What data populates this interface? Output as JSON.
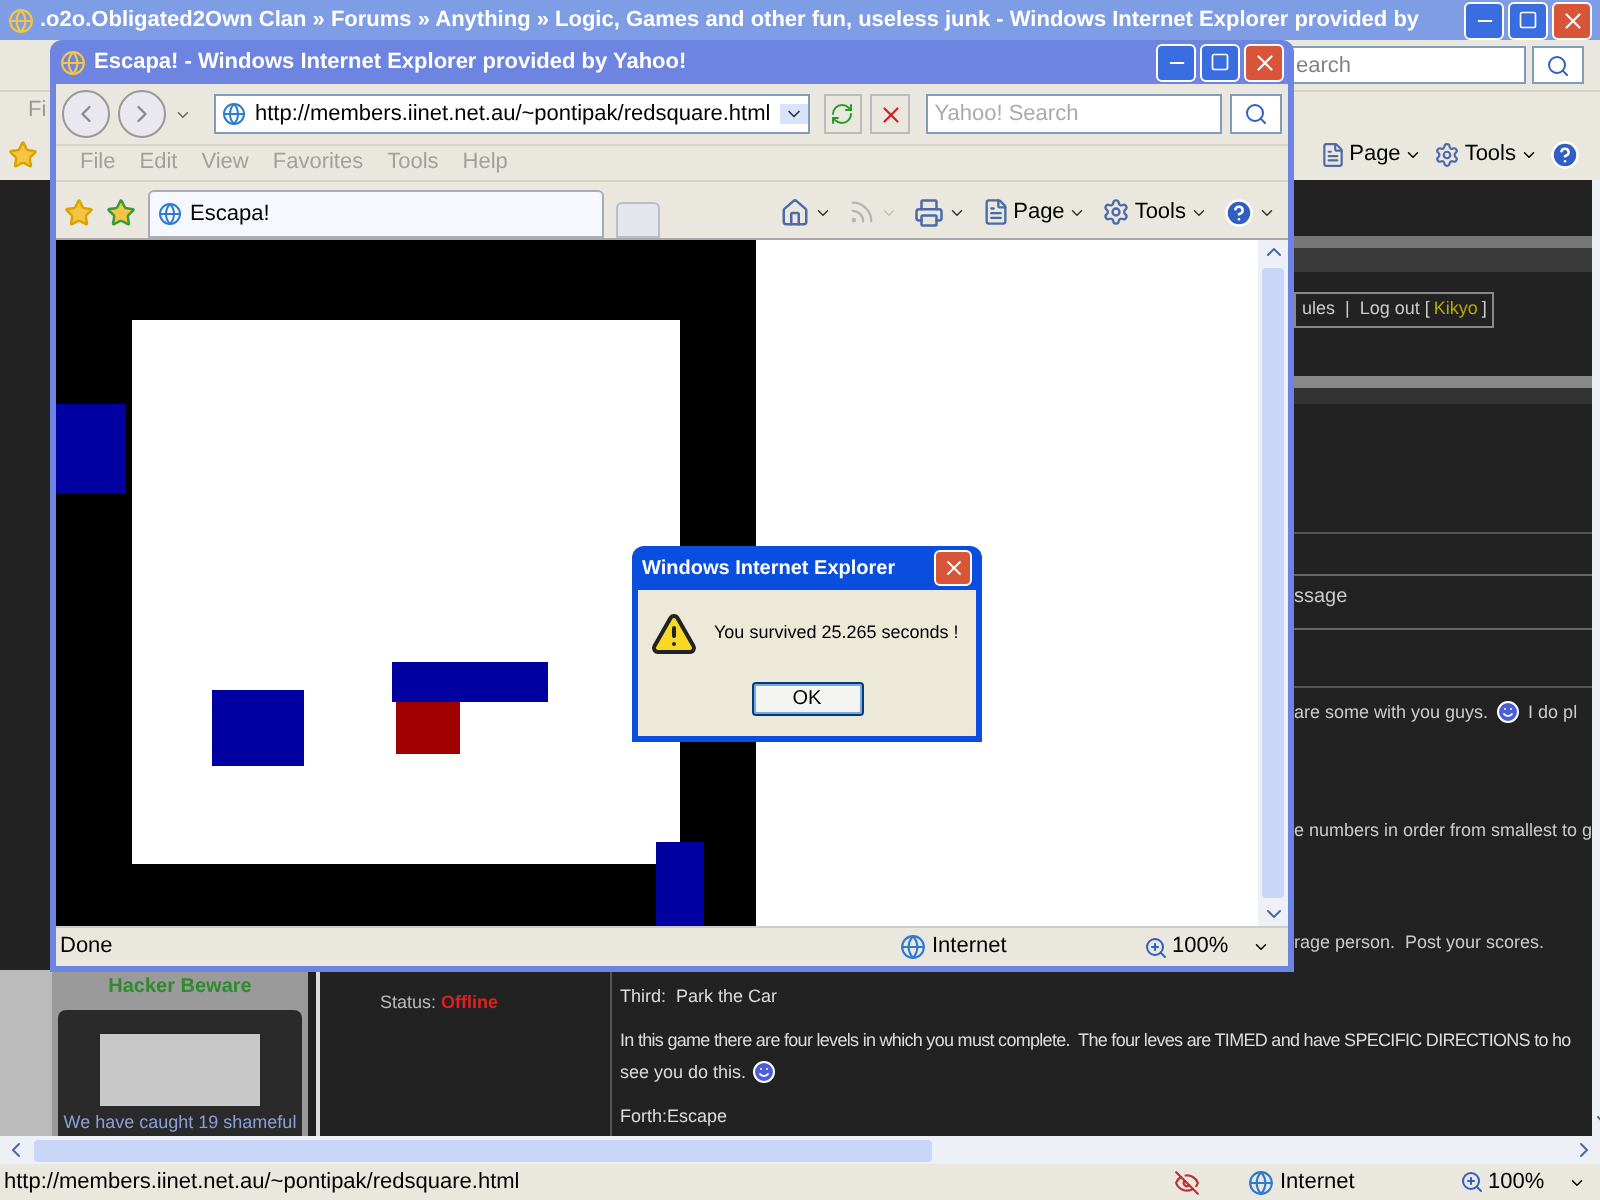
{
  "back_window": {
    "title": ".o2o.Obligated2Own Clan » Forums » Anything » Logic, Games and other fun, useless junk - Windows Internet Explorer provided by",
    "search": {
      "placeholder": "earch"
    },
    "menu": [
      "Fi"
    ],
    "toolbar": [
      "Page",
      "Tools"
    ],
    "forum": {
      "nav": "ules  |  Log out [",
      "user": "Kikyo",
      "nav_end": "]",
      "heading": "ssage",
      "snippets": [
        {
          "text": "are some with you guys.",
          "smiley": true,
          "after": "I do pl"
        },
        {
          "text": "e numbers in order from smallest to g"
        },
        {
          "text": "rage person.  Post your scores."
        }
      ],
      "sidebar": {
        "heading": "Hacker Beware",
        "caption": "We have caught 19 shameful"
      },
      "status_label": "Status:",
      "status_value": "Offline",
      "post": [
        {
          "kind": "line",
          "text": "Third:  Park the Car"
        },
        {
          "kind": "paragraph",
          "text": "In this game there are four levels in which you must complete.  The four leves are TIMED and have SPECIFIC DIRECTIONS to ho",
          "text2": "see you do this."
        },
        {
          "kind": "line",
          "text": "Forth:Escape"
        }
      ]
    },
    "status_bar": {
      "url": "http://members.iinet.net.au/~pontipak/redsquare.html",
      "zone": "Internet",
      "zoom": "100%"
    }
  },
  "front_window": {
    "title": "Escapa! - Windows Internet Explorer provided by Yahoo!",
    "address": "http://members.iinet.net.au/~pontipak/redsquare.html",
    "search": {
      "placeholder": "Yahoo! Search"
    },
    "menu": [
      {
        "label": "File",
        "disabled": true
      },
      {
        "label": "Edit",
        "disabled": true
      },
      {
        "label": "View",
        "disabled": true
      },
      {
        "label": "Favorites",
        "disabled": true
      },
      {
        "label": "Tools",
        "disabled": true
      },
      {
        "label": "Help",
        "disabled": true
      }
    ],
    "tab": {
      "label": "Escapa!",
      "selected": true
    },
    "toolbar": [
      {
        "kind": "home",
        "disabled": false
      },
      {
        "kind": "feeds",
        "disabled": true
      },
      {
        "kind": "print",
        "disabled": false
      },
      {
        "kind": "page",
        "label": "Page",
        "disabled": false
      },
      {
        "kind": "tools",
        "label": "Tools",
        "disabled": false
      },
      {
        "kind": "help",
        "disabled": false
      }
    ],
    "status": "Done",
    "zone": "Internet",
    "zoom": "100%"
  },
  "dialog": {
    "title": "Windows Internet Explorer",
    "message": "You survived 25.265 seconds !",
    "button": "OK"
  }
}
